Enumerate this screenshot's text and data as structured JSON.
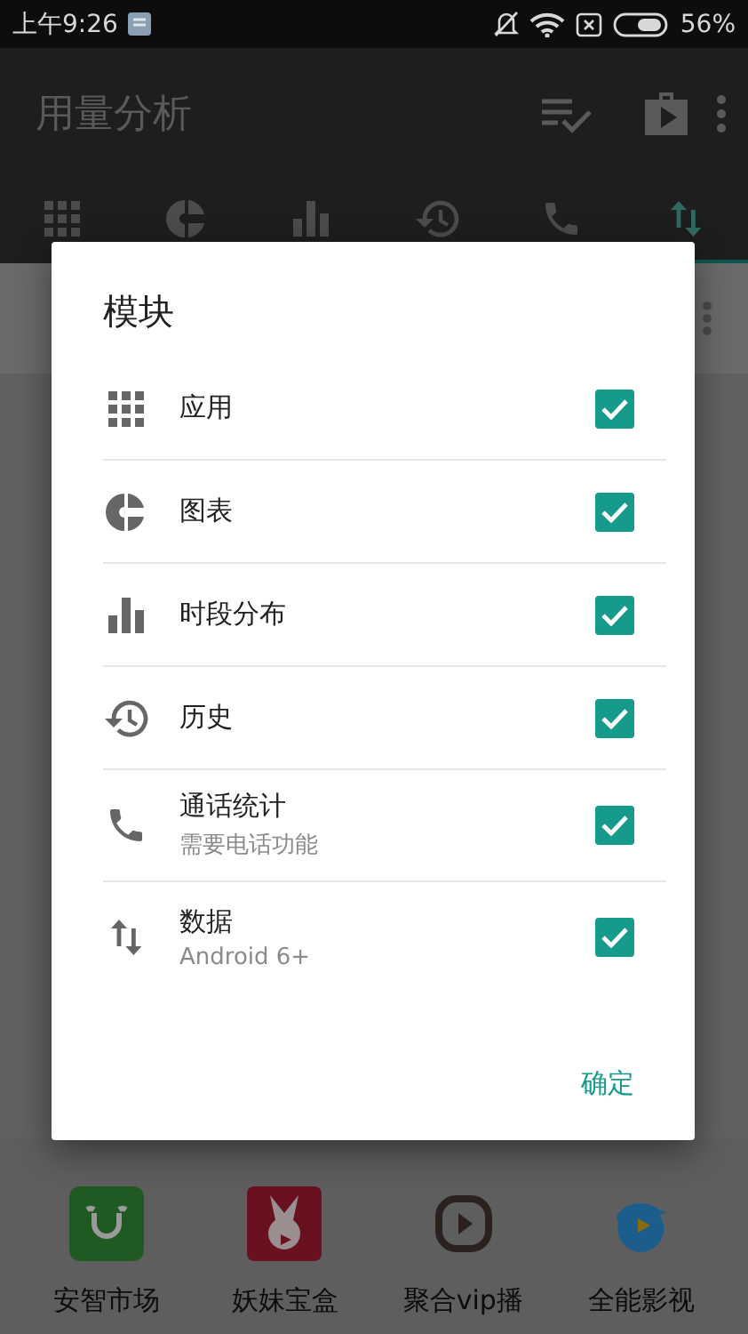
{
  "status_bar": {
    "time": "上午9:26",
    "battery": "56%"
  },
  "app_bar": {
    "title": "用量分析"
  },
  "tabs": [
    {
      "kind": "apps",
      "selected": false
    },
    {
      "kind": "chart",
      "selected": false
    },
    {
      "kind": "bars",
      "selected": false
    },
    {
      "kind": "history",
      "selected": false
    },
    {
      "kind": "call",
      "selected": false
    },
    {
      "kind": "data",
      "selected": true
    }
  ],
  "dialog": {
    "title": "模块",
    "items": [
      {
        "kind": "apps",
        "label": "应用",
        "checked": true
      },
      {
        "kind": "chart",
        "label": "图表",
        "checked": true
      },
      {
        "kind": "bars",
        "label": "时段分布",
        "checked": true
      },
      {
        "kind": "history",
        "label": "历史",
        "checked": true
      },
      {
        "kind": "call",
        "label": "通话统计",
        "sublabel": "需要电话功能",
        "checked": true
      },
      {
        "kind": "data",
        "label": "数据",
        "sublabel": "Android 6+",
        "checked": true
      }
    ],
    "button": "确定"
  },
  "apps": [
    {
      "kind": "market",
      "label": "安智市场"
    },
    {
      "kind": "box",
      "label": "妖妹宝盒"
    },
    {
      "kind": "player",
      "label": "聚合vip播"
    },
    {
      "kind": "video",
      "label": "全能影视"
    }
  ]
}
